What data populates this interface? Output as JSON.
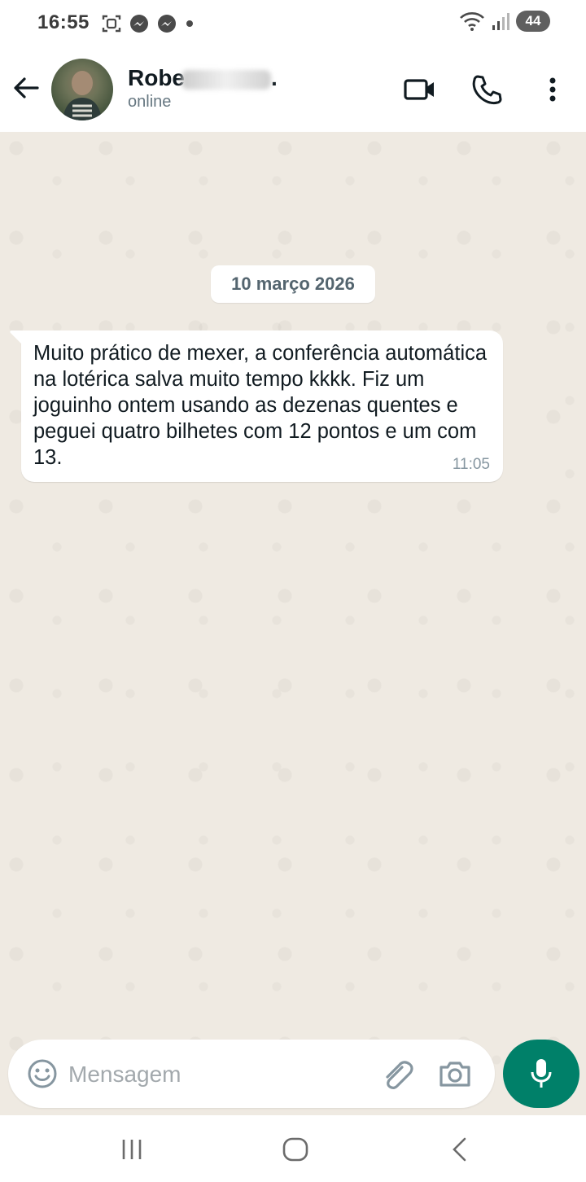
{
  "status_bar": {
    "time": "16:55",
    "battery": "44"
  },
  "header": {
    "contact_name": "Robe",
    "contact_name_suffix": ".",
    "status": "online"
  },
  "chat": {
    "date_label": "10 março 2026",
    "messages": [
      {
        "text": "Muito prático de mexer, a conferência automática na lotérica salva muito tempo kkkk. Fiz um joguinho ontem usando as dezenas quentes e peguei quatro bilhetes com 12 pontos e um com 13.",
        "time": "11:05"
      }
    ]
  },
  "composer": {
    "placeholder": "Mensagem"
  },
  "colors": {
    "accent": "#008069",
    "chat_background": "#efeae2",
    "bubble": "#ffffff"
  },
  "icons": [
    "screenshot-icon",
    "messenger-icon",
    "wifi-icon",
    "signal-icon",
    "back-arrow-icon",
    "video-call-icon",
    "phone-icon",
    "more-options-icon",
    "emoji-icon",
    "attach-icon",
    "camera-icon",
    "mic-icon",
    "recent-apps-icon",
    "home-icon",
    "nav-back-icon"
  ]
}
